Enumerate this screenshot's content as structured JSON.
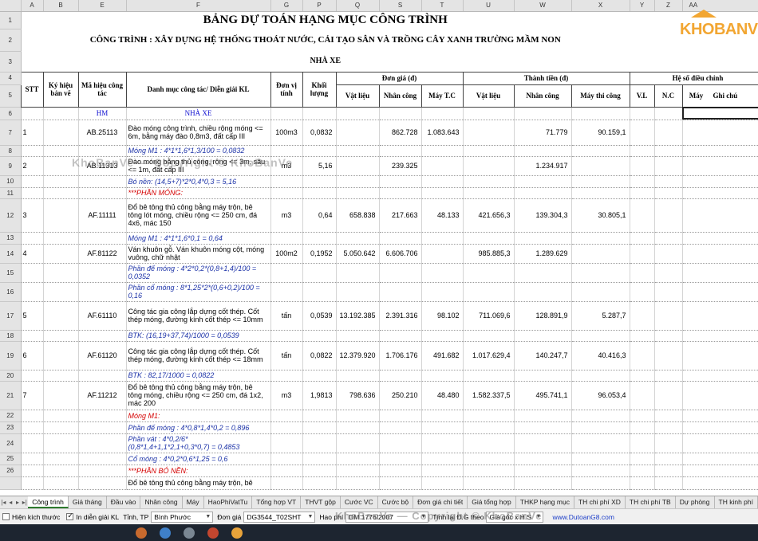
{
  "columns": [
    "",
    "A",
    "B",
    "E",
    "F",
    "G",
    "P",
    "Q",
    "S",
    "T",
    "U",
    "W",
    "X",
    "Y",
    "Z",
    "AA"
  ],
  "titles": {
    "main": "BẢNG DỰ TOÁN HẠNG MỤC CÔNG TRÌNH",
    "project": "CÔNG TRÌNH : XÂY DỰNG HỆ THỐNG THOÁT NƯỚC, CẢI TẠO SÂN VÀ TRỒNG CÂY XANH TRƯỜNG MẦM NON",
    "item": "NHÀ XE"
  },
  "logo": "KHOBANVE",
  "header": {
    "stt": "STT",
    "ky_hieu": "Ký hiệu bản vẽ",
    "ma_hieu": "Mã hiệu công tác",
    "danh_muc": "Danh mục công tác/ Diễn giải KL",
    "don_vi": "Đơn vị tính",
    "khoi_luong": "Khối lượng",
    "don_gia": "Đơn giá (đ)",
    "thanh_tien": "Thành tiền (đ)",
    "he_so": "Hệ số điều chỉnh",
    "ghi_chu": "Ghi chú",
    "vat_lieu": "Vật liệu",
    "nhan_cong": "Nhân công",
    "may_tc": "Máy T.C",
    "tt_vat_lieu": "Vật liệu",
    "tt_nhan_cong": "Nhân công",
    "may_thi_cong": "Máy thi công",
    "vl": "V.L",
    "nc": "N.C",
    "may": "Máy"
  },
  "row_numbers": {
    "r1": "1",
    "r2": "2",
    "r3": "3",
    "r4": "4",
    "r5": "5",
    "r6": "6",
    "r7": "7",
    "r8": "8",
    "r9": "9",
    "r10": "10",
    "r11": "11",
    "r12": "12",
    "r13": "13",
    "r14": "14",
    "r15": "15",
    "r16": "16",
    "r17": "17",
    "r18": "18",
    "r19": "19",
    "r20": "20",
    "r21": "21",
    "r22": "22",
    "r23": "23",
    "r24": "24",
    "r25": "25",
    "r26": "26",
    "r27": ""
  },
  "rows": {
    "r6": {
      "e": "HM",
      "f": "NHÀ XE"
    },
    "r7": {
      "a": "1",
      "e": "AB.25113",
      "f": "Đào móng công trình, chiều rộng móng <= 6m, bằng máy đào 0,8m3, đất cấp III",
      "g": "100m3",
      "p": "0,0832",
      "s": "862.728",
      "t": "1.083.643",
      "w": "71.779",
      "x": "90.159,1"
    },
    "r8": {
      "f": "Móng M1 : 4*1*1,6*1,3/100 = 0,0832"
    },
    "r9": {
      "a": "2",
      "e": "AB.11313",
      "f": "Đào móng bằng thủ công, rộng <= 3m, sâu <= 1m, đất cấp III",
      "g": "m3",
      "p": "5,16",
      "s": "239.325",
      "w": "1.234.917"
    },
    "r10": {
      "f": "Bó nền: (14,5+7)*2*0,4*0,3 = 5,16"
    },
    "r11": {
      "f": "***PHẦN MÓNG:"
    },
    "r12": {
      "a": "3",
      "e": "AF.11111",
      "f": "Đổ bê tông thủ công bằng máy trộn, bê tông lót móng, chiều rộng <= 250 cm, đá 4x6, mác 150",
      "g": "m3",
      "p": "0,64",
      "q": "658.838",
      "s": "217.663",
      "t": "48.133",
      "u": "421.656,3",
      "w": "139.304,3",
      "x": "30.805,1"
    },
    "r13": {
      "f": "Móng M1 : 4*1*1,6*0,1 = 0,64"
    },
    "r14": {
      "a": "4",
      "e": "AF.81122",
      "f": "Ván khuôn gỗ. Ván khuôn móng cột, móng vuông, chữ nhật",
      "g": "100m2",
      "p": "0,1952",
      "q": "5.050.642",
      "s": "6.606.706",
      "u": "985.885,3",
      "w": "1.289.629"
    },
    "r15": {
      "f": "Phần đế móng : 4*2*0,2*(0,8+1,4)/100 = 0,0352"
    },
    "r16": {
      "f": "Phần cổ móng : 8*1,25*2*(0,6+0,2)/100 = 0,16"
    },
    "r17": {
      "a": "5",
      "e": "AF.61110",
      "f": "Công tác gia công lắp dựng cốt thép. Cốt thép móng, đường kính cốt thép <= 10mm",
      "g": "tấn",
      "p": "0,0539",
      "q": "13.192.385",
      "s": "2.391.316",
      "t": "98.102",
      "u": "711.069,6",
      "w": "128.891,9",
      "x": "5.287,7"
    },
    "r18": {
      "f": "BTK: (16,19+37,74)/1000 = 0,0539"
    },
    "r19": {
      "a": "6",
      "e": "AF.61120",
      "f": "Công tác gia công lắp dựng cốt thép. Cốt thép móng, đường kính cốt thép <= 18mm",
      "g": "tấn",
      "p": "0,0822",
      "q": "12.379.920",
      "s": "1.706.176",
      "t": "491.682",
      "u": "1.017.629,4",
      "w": "140.247,7",
      "x": "40.416,3"
    },
    "r20": {
      "f": "BTK : 82,17/1000 = 0,0822"
    },
    "r21": {
      "a": "7",
      "e": "AF.11212",
      "f": "Đổ bê tông thủ công bằng máy trộn, bê tông móng, chiều rộng <= 250 cm, đá 1x2, mác 200",
      "g": "m3",
      "p": "1,9813",
      "q": "798.636",
      "s": "250.210",
      "t": "48.480",
      "u": "1.582.337,5",
      "w": "495.741,1",
      "x": "96.053,4"
    },
    "r22": {
      "f": "Móng M1:"
    },
    "r23": {
      "f": "Phần đế móng : 4*0,8*1,4*0,2 = 0,896"
    },
    "r24": {
      "f": "Phần vát : 4*0,2/6*(0,8*1,4+1,1*2,1+0,3*0,7) = 0,4853"
    },
    "r25": {
      "f": "Cổ móng : 4*0,2*0,6*1,25 = 0,6"
    },
    "r26": {
      "f": "***PHẦN BÓ NỀN:"
    },
    "r27": {
      "f": "Đổ bê tông thủ công bằng máy trộn, bê"
    }
  },
  "sheet_tabs": [
    "Công trình",
    "Giá tháng",
    "Đầu vào",
    "Nhân công",
    "Máy",
    "HaoPhiVatTu",
    "Tổng hợp VT",
    "THVT gộp",
    "Cước VC",
    "Cước bộ",
    "Đơn giá chi tiết",
    "Giá tổng hợp",
    "THKP hạng mục",
    "TH chi phí XD",
    "TH chi phí TB",
    "Dự phòng",
    "TH kinh phí"
  ],
  "active_tab": "Công trình",
  "nav": {
    "first": "|◂",
    "prev": "◂",
    "next": "▸",
    "last": "▸|"
  },
  "statusbar": {
    "hien_kich_thuoc": "Hiện kích thước",
    "in_dien_giai": "In diễn giải KL",
    "tinh_tp_label": "Tỉnh, TP",
    "tinh_tp_value": "Bình Phước",
    "don_gia_label": "Đơn giá",
    "don_gia_value": "DG3544_T02SHT",
    "nhan_cong_label": "Hao phí",
    "nhan_cong_value": "DM 1776/2007",
    "tinh_lai_label": "Tính lại Đ.G theo",
    "tinh_lai_value": "Giá gốc x H.S",
    "website": "www.DutoanG8.com"
  },
  "watermark": "KhoBanVe — Copyright © KhoBanVe"
}
